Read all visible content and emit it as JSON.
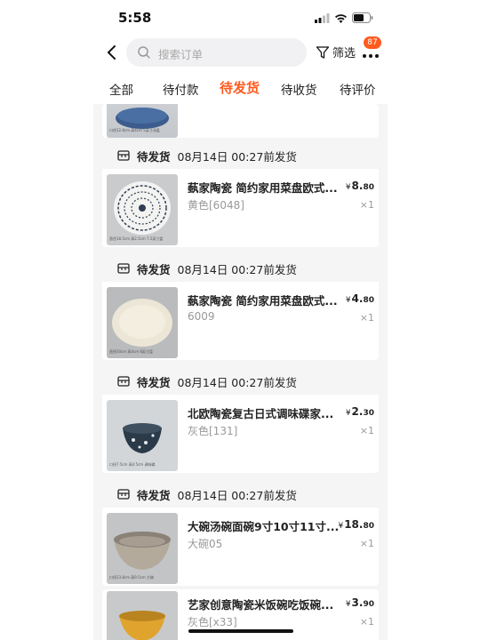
{
  "status_bar": {
    "time": "5:58"
  },
  "search": {
    "placeholder": "搜索订单"
  },
  "toolbar": {
    "filter_label": "筛选",
    "badge": "87"
  },
  "tabs": [
    {
      "label": "全部"
    },
    {
      "label": "待付款"
    },
    {
      "label": "待发货",
      "active": true
    },
    {
      "label": "待收货"
    },
    {
      "label": "待评价"
    }
  ],
  "top_item": {
    "caption": "口径12.8cm 高4cm 5英寸汤盘"
  },
  "orders": [
    {
      "status": "待发货",
      "deadline": "08月14日 00:27前发货",
      "title": "蓺家陶瓷 简约家用菜盘欧式...",
      "price_currency": "¥",
      "price_int": "8.",
      "price_dec": "80",
      "spec": "黄色[6048]",
      "qty": "×1",
      "thumb_caption": "直径18.5cm 高2.5cm 7.5英寸盘"
    },
    {
      "status": "待发货",
      "deadline": "08月14日 00:27前发货",
      "title": "蓺家陶瓷 简约家用菜盘欧式...",
      "price_currency": "¥",
      "price_int": "4.",
      "price_dec": "80",
      "spec": "6009",
      "qty": "×1",
      "thumb_caption": "直径20cm 高4cm 8英寸盘"
    },
    {
      "status": "待发货",
      "deadline": "08月14日 00:27前发货",
      "title": "北欧陶瓷复古日式调味碟家...",
      "price_currency": "¥",
      "price_int": "2.",
      "price_dec": "30",
      "spec": "灰色[131]",
      "qty": "×1",
      "thumb_caption": "口径7.5cm 高4.5cm 调味碟"
    },
    {
      "status": "待发货",
      "deadline": "08月14日 00:27前发货",
      "title": "大碗汤碗面碗9寸10寸11寸...",
      "price_currency": "¥",
      "price_int": "18.",
      "price_dec": "80",
      "spec": "大碗05",
      "qty": "×1",
      "thumb_caption": "口径23.8cm 高9.5cm 大碗"
    },
    {
      "status": "",
      "deadline": "",
      "title": "艺家创意陶瓷米饭碗吃饭碗...",
      "price_currency": "¥",
      "price_int": "3.",
      "price_dec": "90",
      "spec": "灰色[x33]",
      "qty": "×1",
      "thumb_caption": ""
    }
  ],
  "colors": {
    "accent": "#ff5a1f",
    "bg": "#f5f5f5",
    "text": "#222222",
    "muted": "#999999"
  }
}
